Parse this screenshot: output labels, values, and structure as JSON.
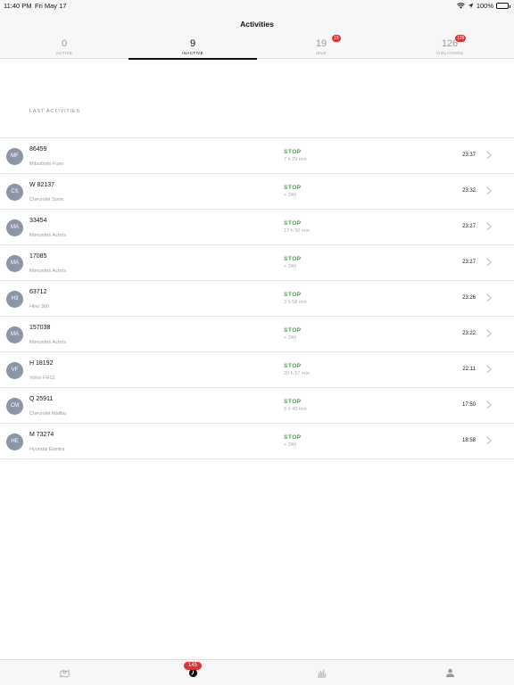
{
  "status_bar": {
    "time": "11:40 PM",
    "date": "Fri May 17",
    "battery": "100%"
  },
  "nav": {
    "title": "Activities"
  },
  "segments": [
    {
      "count": "0",
      "label": "ACTIVE",
      "badge": ""
    },
    {
      "count": "9",
      "label": "INACTIVE",
      "badge": ""
    },
    {
      "count": "19",
      "label": "IDLE",
      "badge": "19"
    },
    {
      "count": "126",
      "label": "VIOLATIONS",
      "badge": "126"
    }
  ],
  "section_title": "LAST ACTIVITIES",
  "activities": [
    {
      "initials": "MF",
      "plate": "86459",
      "model": "Mitsubishi Fuso",
      "status": "STOP",
      "duration": "7 h 29 min",
      "time": "23:37"
    },
    {
      "initials": "CS",
      "plate": "W 82137",
      "model": "Chevrolet Sonic",
      "status": "STOP",
      "duration": "+ 24h",
      "time": "23:32"
    },
    {
      "initials": "MA",
      "plate": "33454",
      "model": "Mercedes Actros",
      "status": "STOP",
      "duration": "17 h 50 min",
      "time": "23:27"
    },
    {
      "initials": "MA",
      "plate": "17085",
      "model": "Mercedes Actros",
      "status": "STOP",
      "duration": "+ 24h",
      "time": "23:27"
    },
    {
      "initials": "H3",
      "plate": "63712",
      "model": "Hino 300",
      "status": "STOP",
      "duration": "3 h 58 min",
      "time": "23:26"
    },
    {
      "initials": "MA",
      "plate": "157038",
      "model": "Mercedes Actros",
      "status": "STOP",
      "duration": "+ 24h",
      "time": "23:22"
    },
    {
      "initials": "VF",
      "plate": "H 18192",
      "model": "Volvo FH12",
      "status": "STOP",
      "duration": "20 h 57 min",
      "time": "22:11"
    },
    {
      "initials": "CM",
      "plate": "Q 25911",
      "model": "Chevrolet Malibu",
      "status": "STOP",
      "duration": "5 h 49 min",
      "time": "17:50"
    },
    {
      "initials": "HE",
      "plate": "M 73274",
      "model": "Hyundai Elantra",
      "status": "STOP",
      "duration": "+ 24h",
      "time": "18:58"
    }
  ],
  "tabbar": {
    "tabs": [
      {
        "icon": "map-icon",
        "badge": ""
      },
      {
        "icon": "clock-icon",
        "badge": "145"
      },
      {
        "icon": "bar-chart-icon",
        "badge": ""
      },
      {
        "icon": "user-icon",
        "badge": ""
      }
    ]
  },
  "colors": {
    "accent_red": "#e5312f",
    "stop_green": "#3aa63a",
    "avatar_gray": "#8e95a6"
  }
}
